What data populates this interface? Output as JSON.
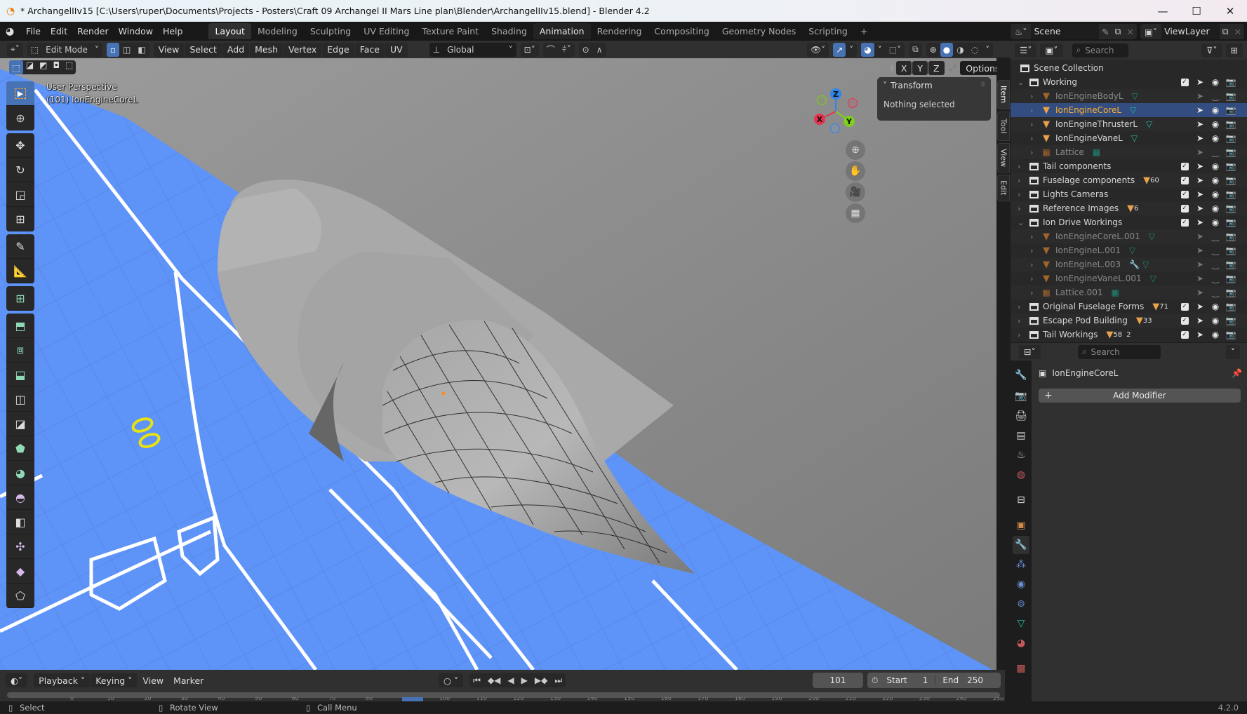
{
  "window": {
    "title": "* ArchangelIIv15 [C:\\Users\\ruper\\Documents\\Projects - Posters\\Craft 09 Archangel II Mars Line plan\\Blender\\ArchangelIIv15.blend] - Blender 4.2",
    "minimize": "—",
    "maximize": "☐",
    "close": "✕"
  },
  "menu": [
    "File",
    "Edit",
    "Render",
    "Window",
    "Help"
  ],
  "workspaces": [
    "Layout",
    "Modeling",
    "Sculpting",
    "UV Editing",
    "Texture Paint",
    "Shading",
    "Animation",
    "Rendering",
    "Compositing",
    "Geometry Nodes",
    "Scripting",
    "+"
  ],
  "active_workspace": "Layout",
  "scene": {
    "label": "Scene",
    "viewlayer": "ViewLayer"
  },
  "viewport_header": {
    "mode": "Edit Mode",
    "menus": [
      "View",
      "Select",
      "Add",
      "Mesh",
      "Vertex",
      "Edge",
      "Face",
      "UV"
    ],
    "orientation": "Global",
    "mirror_axes": [
      "X",
      "Y",
      "Z"
    ],
    "options": "Options"
  },
  "viewport": {
    "perspective": "User Perspective",
    "object_info": "(101) IonEngineCoreL",
    "gizmo_axes": {
      "x": "X",
      "y": "Y",
      "z": "Z"
    },
    "colors": {
      "blueprint": "#5e93f7",
      "mesh": "#a8a8a8",
      "x_axis": "#e5324f",
      "y_axis": "#7ecf1d",
      "z_axis": "#2f85e9"
    }
  },
  "npanel": {
    "section": "Transform",
    "message": "Nothing selected",
    "tabs": [
      "Item",
      "Tool",
      "View",
      "Edit"
    ],
    "active_tab": "Item"
  },
  "outliner": {
    "search_placeholder": "Search",
    "root": "Scene Collection",
    "rows": [
      {
        "name": "Working",
        "type": "collection",
        "depth": 0,
        "expanded": true,
        "checked": true,
        "visible": true
      },
      {
        "name": "IonEngineBodyL",
        "type": "mesh",
        "depth": 1,
        "dim": true,
        "visible": false
      },
      {
        "name": "IonEngineCoreL",
        "type": "mesh",
        "depth": 1,
        "selected": true,
        "visible": true
      },
      {
        "name": "IonEngineThrusterL",
        "type": "mesh",
        "depth": 1,
        "visible": true
      },
      {
        "name": "IonEngineVaneL",
        "type": "mesh",
        "depth": 1,
        "visible": true
      },
      {
        "name": "Lattice",
        "type": "lattice",
        "depth": 1,
        "dim": true,
        "visible": false
      },
      {
        "name": "Tail components",
        "type": "collection",
        "depth": 0,
        "checked": true,
        "visible": true
      },
      {
        "name": "Fuselage components",
        "type": "collection",
        "depth": 0,
        "checked": true,
        "visible": true,
        "badge": "60"
      },
      {
        "name": "Lights Cameras",
        "type": "collection",
        "depth": 0,
        "checked": true,
        "visible": true
      },
      {
        "name": "Reference Images",
        "type": "collection",
        "depth": 0,
        "checked": true,
        "visible": true,
        "badge": "6"
      },
      {
        "name": "Ion Drive Workings",
        "type": "collection",
        "depth": 0,
        "expanded": true,
        "checked": true,
        "visible": true
      },
      {
        "name": "IonEngineCoreL.001",
        "type": "mesh",
        "depth": 1,
        "dim": true,
        "visible": false
      },
      {
        "name": "IonEngineL.001",
        "type": "mesh",
        "depth": 1,
        "dim": true,
        "visible": false
      },
      {
        "name": "IonEngineL.003",
        "type": "mesh",
        "depth": 1,
        "dim": true,
        "visible": false,
        "modifier": true
      },
      {
        "name": "IonEngineVaneL.001",
        "type": "mesh",
        "depth": 1,
        "dim": true,
        "visible": false
      },
      {
        "name": "Lattice.001",
        "type": "lattice",
        "depth": 1,
        "dim": true,
        "visible": false
      },
      {
        "name": "Original Fuselage Forms",
        "type": "collection",
        "depth": 0,
        "checked": true,
        "visible": true,
        "badge": "71"
      },
      {
        "name": "Escape Pod Building",
        "type": "collection",
        "depth": 0,
        "checked": true,
        "visible": true,
        "badge": "33"
      },
      {
        "name": "Tail Workings",
        "type": "collection",
        "depth": 0,
        "checked": true,
        "visible": true,
        "badge": "58",
        "badge2": "2"
      }
    ]
  },
  "properties": {
    "search_placeholder": "Search",
    "object_name": "IonEngineCoreL",
    "add_modifier": "Add Modifier",
    "active_tab": "modifiers"
  },
  "timeline": {
    "menus": [
      "Playback",
      "Keying",
      "View",
      "Marker"
    ],
    "current_frame": "101",
    "start_label": "Start",
    "start": "1",
    "end_label": "End",
    "end": "250",
    "ticks": [
      "0",
      "10",
      "20",
      "30",
      "40",
      "50",
      "60",
      "70",
      "80",
      "90",
      "100",
      "110",
      "120",
      "130",
      "140",
      "150",
      "160",
      "170",
      "180",
      "190",
      "200",
      "210",
      "220",
      "230",
      "240",
      "250"
    ]
  },
  "statusbar": {
    "left": "Select",
    "middle": "Rotate View",
    "right": "Call Menu",
    "version": "4.2.0"
  }
}
